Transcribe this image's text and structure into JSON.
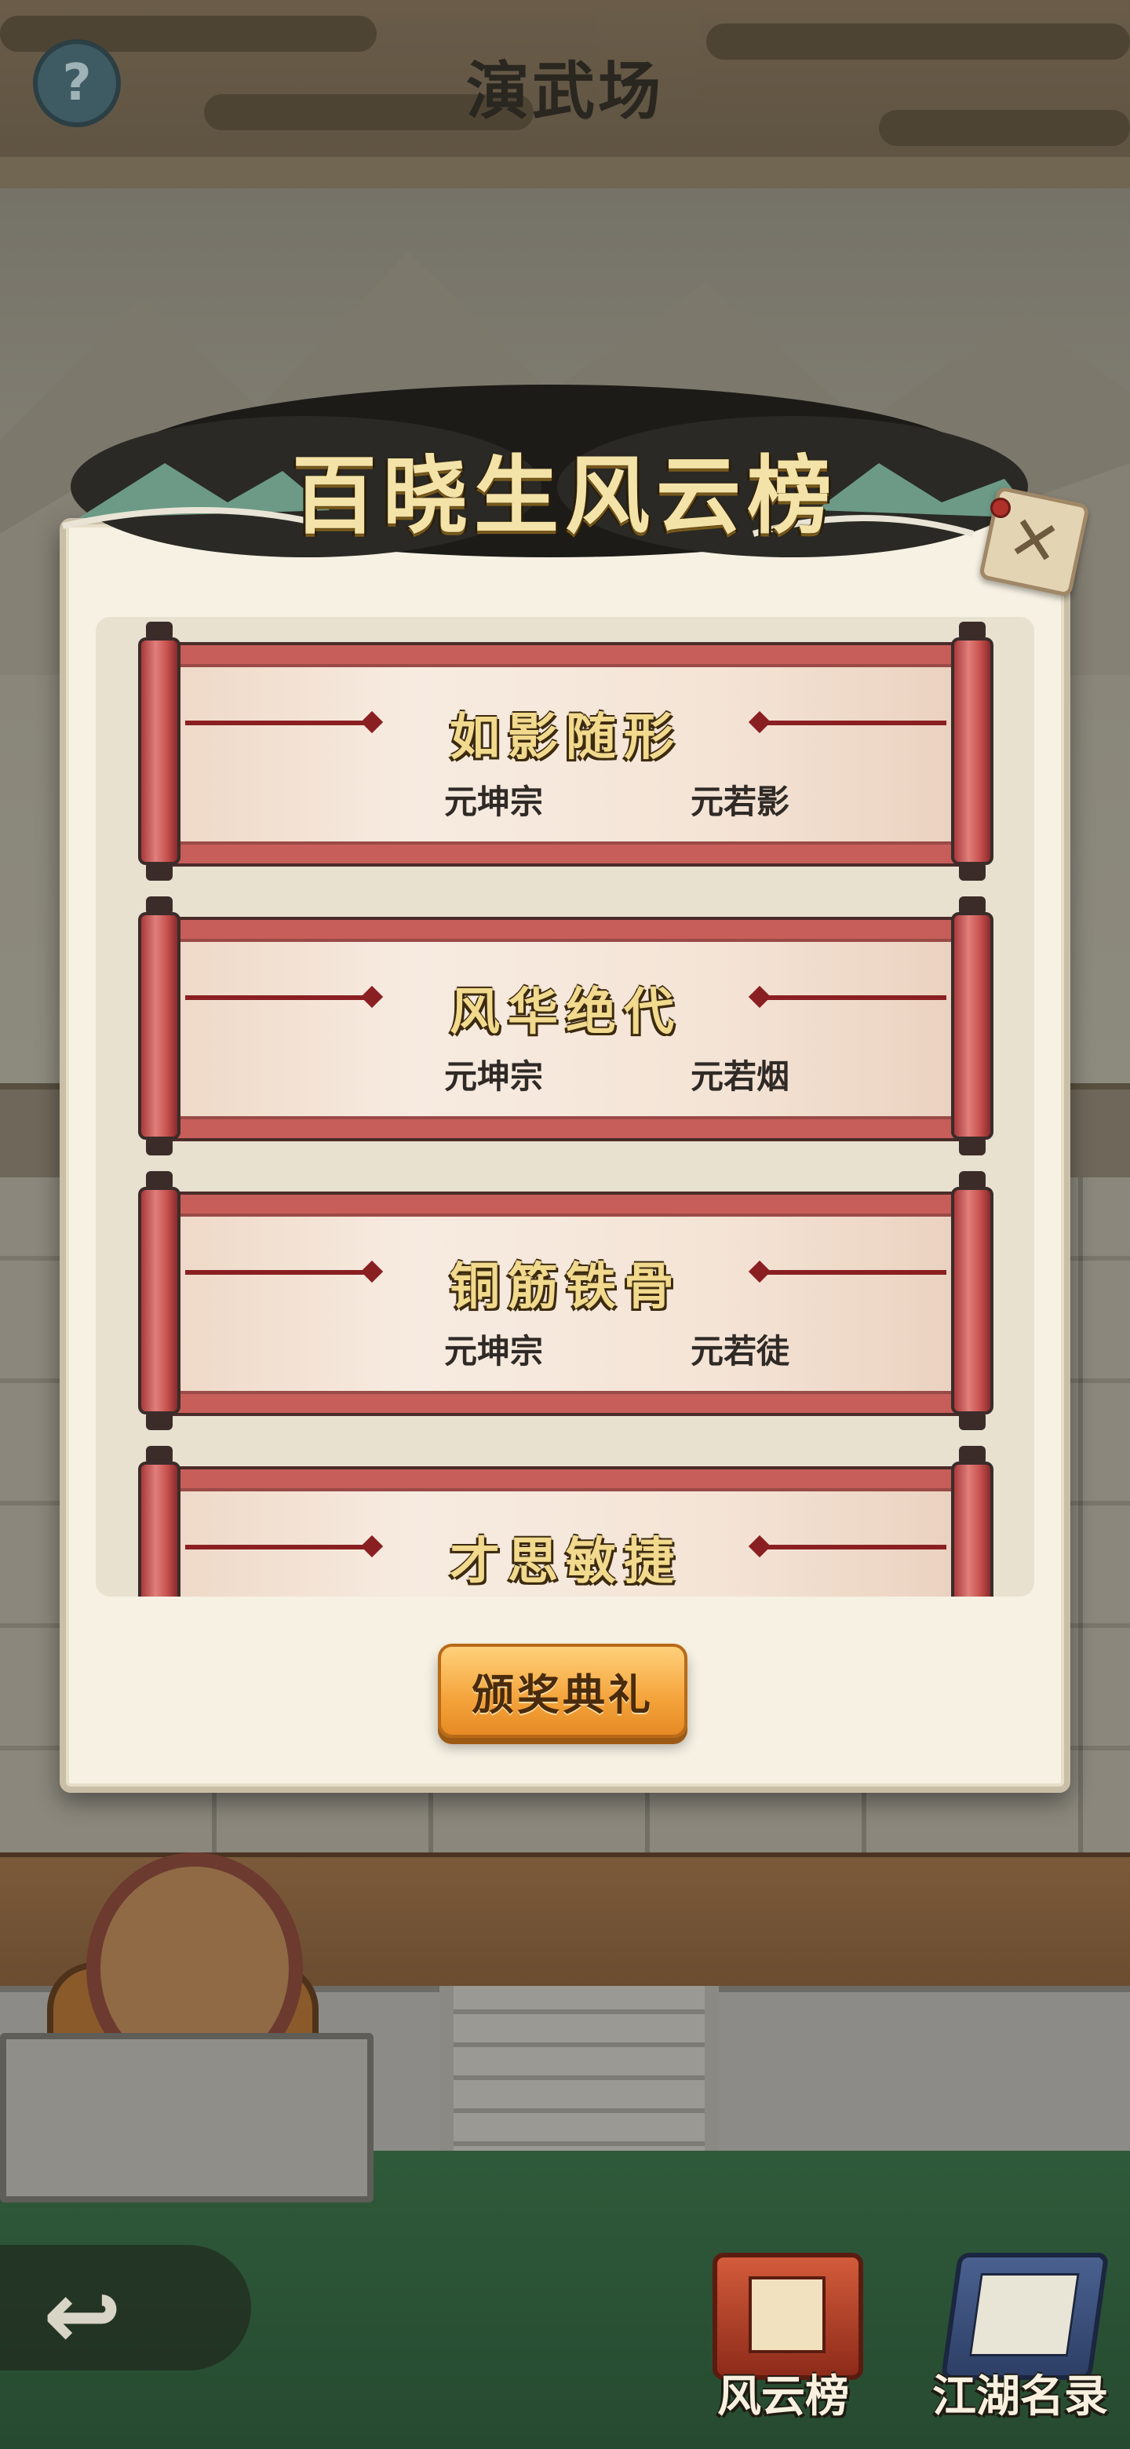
{
  "header": {
    "title": "演武场",
    "help_icon": "question-mark-icon"
  },
  "modal": {
    "title": "百晓生风云榜",
    "close_icon": "close-icon",
    "awards": [
      {
        "title": "如影随形",
        "sect": "元坤宗",
        "winner": "元若影"
      },
      {
        "title": "风华绝代",
        "sect": "元坤宗",
        "winner": "元若烟"
      },
      {
        "title": "铜筋铁骨",
        "sect": "元坤宗",
        "winner": "元若徒"
      },
      {
        "title": "才思敏捷",
        "sect": "",
        "winner": ""
      }
    ],
    "ceremony_button": "颁奖典礼"
  },
  "bottom_bar": {
    "back_icon": "back-arrow-icon",
    "items": [
      {
        "label": "风云榜",
        "icon": "ranking-scroll-icon"
      },
      {
        "label": "江湖名录",
        "icon": "book-icon"
      }
    ]
  },
  "colors": {
    "modal_bg": "#f6f1e3",
    "scroll_red": "#c75e5a",
    "title_gold": "#f4e3a8",
    "button_orange": "#f4a33b"
  }
}
